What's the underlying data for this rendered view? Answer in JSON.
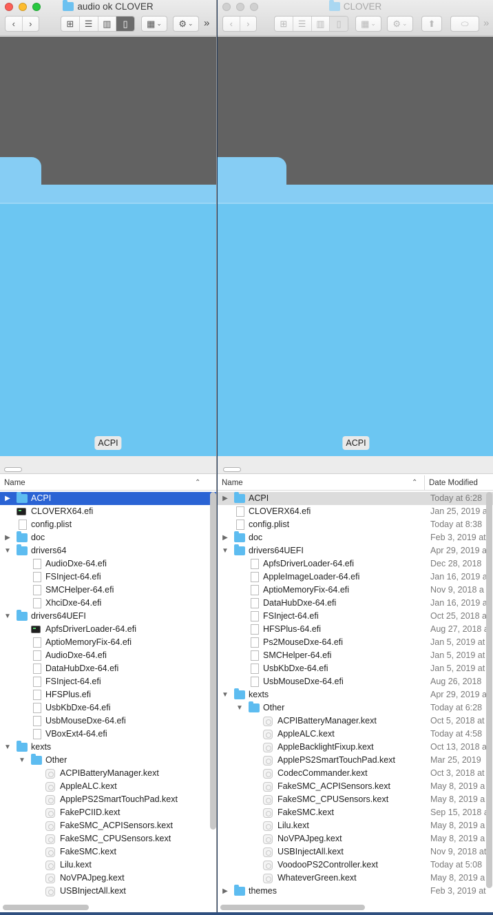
{
  "left": {
    "title": "audio ok CLOVER",
    "toolbar": {
      "back": "‹",
      "forward": "›",
      "more": "»"
    },
    "flow_label": "ACPI",
    "header": {
      "name": "Name"
    },
    "rows": [
      {
        "name": "ACPI",
        "type": "folder",
        "level": 0,
        "tri": "▶",
        "sel": "blue"
      },
      {
        "name": "CLOVERX64.efi",
        "type": "exec",
        "level": 0
      },
      {
        "name": "config.plist",
        "type": "file",
        "level": 0
      },
      {
        "name": "doc",
        "type": "folder",
        "level": 0,
        "tri": "▶"
      },
      {
        "name": "drivers64",
        "type": "folder",
        "level": 0,
        "tri": "▼"
      },
      {
        "name": "AudioDxe-64.efi",
        "type": "file",
        "level": 1
      },
      {
        "name": "FSInject-64.efi",
        "type": "file",
        "level": 1
      },
      {
        "name": "SMCHelper-64.efi",
        "type": "file",
        "level": 1
      },
      {
        "name": "XhciDxe-64.efi",
        "type": "file",
        "level": 1
      },
      {
        "name": "drivers64UEFI",
        "type": "folder",
        "level": 0,
        "tri": "▼"
      },
      {
        "name": "ApfsDriverLoader-64.efi",
        "type": "exec",
        "level": 1
      },
      {
        "name": "AptioMemoryFix-64.efi",
        "type": "file",
        "level": 1
      },
      {
        "name": "AudioDxe-64.efi",
        "type": "file",
        "level": 1
      },
      {
        "name": "DataHubDxe-64.efi",
        "type": "file",
        "level": 1
      },
      {
        "name": "FSInject-64.efi",
        "type": "file",
        "level": 1
      },
      {
        "name": "HFSPlus.efi",
        "type": "file",
        "level": 1
      },
      {
        "name": "UsbKbDxe-64.efi",
        "type": "file",
        "level": 1
      },
      {
        "name": "UsbMouseDxe-64.efi",
        "type": "file",
        "level": 1
      },
      {
        "name": "VBoxExt4-64.efi",
        "type": "file",
        "level": 1
      },
      {
        "name": "kexts",
        "type": "folder",
        "level": 0,
        "tri": "▼"
      },
      {
        "name": "Other",
        "type": "folder",
        "level": 1,
        "tri": "▼"
      },
      {
        "name": "ACPIBatteryManager.kext",
        "type": "kext",
        "level": 2
      },
      {
        "name": "AppleALC.kext",
        "type": "kext",
        "level": 2
      },
      {
        "name": "ApplePS2SmartTouchPad.kext",
        "type": "kext",
        "level": 2
      },
      {
        "name": "FakePCIID.kext",
        "type": "kext",
        "level": 2
      },
      {
        "name": "FakeSMC_ACPISensors.kext",
        "type": "kext",
        "level": 2
      },
      {
        "name": "FakeSMC_CPUSensors.kext",
        "type": "kext",
        "level": 2
      },
      {
        "name": "FakeSMC.kext",
        "type": "kext",
        "level": 2
      },
      {
        "name": "Lilu.kext",
        "type": "kext",
        "level": 2
      },
      {
        "name": "NoVPAJpeg.kext",
        "type": "kext",
        "level": 2
      },
      {
        "name": "USBInjectAll.kext",
        "type": "kext",
        "level": 2
      }
    ]
  },
  "right": {
    "title": "CLOVER",
    "toolbar": {
      "back": "‹",
      "forward": "›",
      "more": "»"
    },
    "flow_label": "ACPI",
    "header": {
      "name": "Name",
      "date": "Date Modified"
    },
    "rows": [
      {
        "name": "ACPI",
        "type": "folder",
        "level": 0,
        "tri": "▶",
        "sel": "gray",
        "date": "Today at 6:28"
      },
      {
        "name": "CLOVERX64.efi",
        "type": "file",
        "level": 0,
        "date": "Jan 25, 2019 a"
      },
      {
        "name": "config.plist",
        "type": "file",
        "level": 0,
        "date": "Today at 8:38"
      },
      {
        "name": "doc",
        "type": "folder",
        "level": 0,
        "tri": "▶",
        "date": "Feb 3, 2019 at"
      },
      {
        "name": "drivers64UEFI",
        "type": "folder",
        "level": 0,
        "tri": "▼",
        "date": "Apr 29, 2019 a"
      },
      {
        "name": "ApfsDriverLoader-64.efi",
        "type": "file",
        "level": 1,
        "date": "Dec 28, 2018"
      },
      {
        "name": "AppleImageLoader-64.efi",
        "type": "file",
        "level": 1,
        "date": "Jan 16, 2019 a"
      },
      {
        "name": "AptioMemoryFix-64.efi",
        "type": "file",
        "level": 1,
        "date": "Nov 9, 2018 a"
      },
      {
        "name": "DataHubDxe-64.efi",
        "type": "file",
        "level": 1,
        "date": "Jan 16, 2019 a"
      },
      {
        "name": "FSInject-64.efi",
        "type": "file",
        "level": 1,
        "date": "Oct 25, 2018 a"
      },
      {
        "name": "HFSPlus-64.efi",
        "type": "file",
        "level": 1,
        "date": "Aug 27, 2018 a"
      },
      {
        "name": "Ps2MouseDxe-64.efi",
        "type": "file",
        "level": 1,
        "date": "Jan 5, 2019 at"
      },
      {
        "name": "SMCHelper-64.efi",
        "type": "file",
        "level": 1,
        "date": "Jan 5, 2019 at"
      },
      {
        "name": "UsbKbDxe-64.efi",
        "type": "file",
        "level": 1,
        "date": "Jan 5, 2019 at"
      },
      {
        "name": "UsbMouseDxe-64.efi",
        "type": "file",
        "level": 1,
        "date": "Aug 26, 2018"
      },
      {
        "name": "kexts",
        "type": "folder",
        "level": 0,
        "tri": "▼",
        "date": "Apr 29, 2019 a"
      },
      {
        "name": "Other",
        "type": "folder",
        "level": 1,
        "tri": "▼",
        "date": "Today at 6:28"
      },
      {
        "name": "ACPIBatteryManager.kext",
        "type": "kext",
        "level": 2,
        "date": "Oct 5, 2018 at"
      },
      {
        "name": "AppleALC.kext",
        "type": "kext",
        "level": 2,
        "date": "Today at 4:58"
      },
      {
        "name": "AppleBacklightFixup.kext",
        "type": "kext",
        "level": 2,
        "date": "Oct 13, 2018 a"
      },
      {
        "name": "ApplePS2SmartTouchPad.kext",
        "type": "kext",
        "level": 2,
        "date": "Mar 25, 2019"
      },
      {
        "name": "CodecCommander.kext",
        "type": "kext",
        "level": 2,
        "date": "Oct 3, 2018 at"
      },
      {
        "name": "FakeSMC_ACPISensors.kext",
        "type": "kext",
        "level": 2,
        "date": "May 8, 2019 a"
      },
      {
        "name": "FakeSMC_CPUSensors.kext",
        "type": "kext",
        "level": 2,
        "date": "May 8, 2019 a"
      },
      {
        "name": "FakeSMC.kext",
        "type": "kext",
        "level": 2,
        "date": "Sep 15, 2018 a"
      },
      {
        "name": "Lilu.kext",
        "type": "kext",
        "level": 2,
        "date": "May 8, 2019 a"
      },
      {
        "name": "NoVPAJpeg.kext",
        "type": "kext",
        "level": 2,
        "date": "May 8, 2019 a"
      },
      {
        "name": "USBInjectAll.kext",
        "type": "kext",
        "level": 2,
        "date": "Nov 9, 2018 at"
      },
      {
        "name": "VoodooPS2Controller.kext",
        "type": "kext",
        "level": 2,
        "date": "Today at 5:08"
      },
      {
        "name": "WhateverGreen.kext",
        "type": "kext",
        "level": 2,
        "date": "May 8, 2019 a"
      },
      {
        "name": "themes",
        "type": "folder",
        "level": 0,
        "tri": "▶",
        "date": "Feb 3, 2019 at"
      }
    ]
  },
  "icons": {
    "view_icons": "⊞",
    "view_list": "☰",
    "view_columns": "▥",
    "view_coverflow": "▯",
    "arrange": "▦",
    "action_gear": "⚙",
    "share": "⬆",
    "tags": "⬭",
    "chevron": "⌄",
    "expanded": "▼",
    "collapsed": "▶",
    "sort_up": "⌃"
  },
  "colors": {
    "selection": "#2a63d4",
    "folder": "#5dbcf0",
    "flow_bg": "#626262"
  }
}
